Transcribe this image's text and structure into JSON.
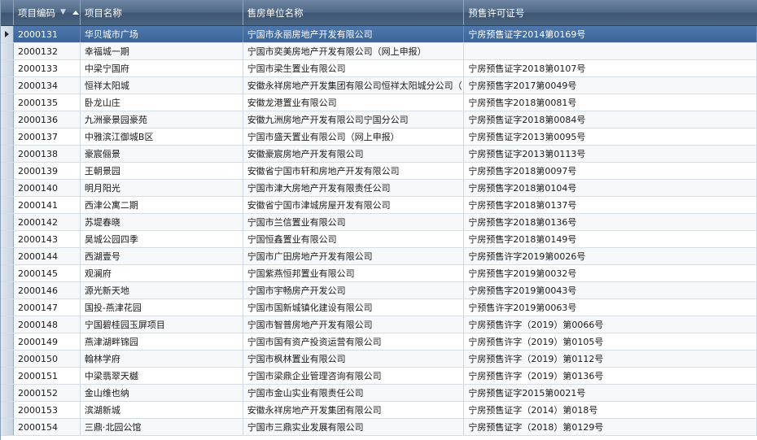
{
  "columns": {
    "code": "项目编码",
    "name": "项目名称",
    "company": "售房单位名称",
    "license": "预售许可证号"
  },
  "rows": [
    {
      "code": "2000131",
      "name": "华贝城市广场",
      "company": "宁国市永丽房地产开发有限公司",
      "license": "宁房预售证字2014第0169号"
    },
    {
      "code": "2000132",
      "name": "幸福城一期",
      "company": "宁国市奕美房地产开发有限公司（网上申报）",
      "license": ""
    },
    {
      "code": "2000133",
      "name": "中梁宁国府",
      "company": "宁国市梁生置业有限公司",
      "license": "宁房预售证字2018第0107号"
    },
    {
      "code": "2000134",
      "name": "恒祥太阳城",
      "company": "安徽永祥房地产开发集团有限公司恒祥太阳城分公司（",
      "license": "宁房预售字2017第0049号"
    },
    {
      "code": "2000135",
      "name": "卧龙山庄",
      "company": "安徽龙港置业有限公司",
      "license": "宁房预售字2018第0081号"
    },
    {
      "code": "2000136",
      "name": "九洲豪景园豪苑",
      "company": "安徽九洲房地产开发有限公司宁国分公司",
      "license": "宁房预售证字2018第0084号"
    },
    {
      "code": "2000137",
      "name": "中雅滨江御城B区",
      "company": "宁国市盛天置业有限公司（网上申报）",
      "license": "宁房预售证字2013第0095号"
    },
    {
      "code": "2000138",
      "name": "豪宸俪景",
      "company": "安徽豪宸房地产开发有限公司",
      "license": "宁房预售证字2013第0113号"
    },
    {
      "code": "2000139",
      "name": "王朝景园",
      "company": "安徽省宁国市轩和房地产开发有限公司",
      "license": "宁房预售字2018第0097号"
    },
    {
      "code": "2000140",
      "name": "明月阳光",
      "company": "宁国市津大房地产开发有限责任公司",
      "license": "宁房预售字2018第0104号"
    },
    {
      "code": "2000141",
      "name": "西津公寓二期",
      "company": "安徽省宁国市津城房屋开发有限公司",
      "license": "宁房预售字2018第0137号"
    },
    {
      "code": "2000142",
      "name": "苏堤春晓",
      "company": "宁国市兰信置业有限公司",
      "license": "宁房预售字2018第0136号"
    },
    {
      "code": "2000143",
      "name": "昊城公园四季",
      "company": "宁国恒鑫置业有限公司",
      "license": "宁房预售字2018第0149号"
    },
    {
      "code": "2000144",
      "name": "西湖壹号",
      "company": "宁国市广田房地产开发有限公司",
      "license": "宁房预售许字2019第0026号"
    },
    {
      "code": "2000145",
      "name": "观澜府",
      "company": "宁国紫燕恒邦置业有限公司",
      "license": "宁房预售字2019第0032号"
    },
    {
      "code": "2000146",
      "name": "源光新天地",
      "company": "宁国市宇畅房产开发公司",
      "license": "宁房预售字2019第0043号"
    },
    {
      "code": "2000147",
      "name": "国投-燕津花园",
      "company": "宁国市国新城镇化建设有限公司",
      "license": "宁预售许字2019第0063号"
    },
    {
      "code": "2000148",
      "name": "宁国碧桂园玉屏项目",
      "company": "宁国市智普房地产开发有限公司",
      "license": "宁房预售许字（2019）第0066号"
    },
    {
      "code": "2000149",
      "name": "燕津湖畔锦园",
      "company": "宁国市国有资产投资运营有限公司",
      "license": "宁房预售许字（2019）第0105号"
    },
    {
      "code": "2000150",
      "name": "翰林学府",
      "company": "宁国市枫林置业有限公司",
      "license": "宁房预售许字（2019）第0112号"
    },
    {
      "code": "2000151",
      "name": "中梁翡翠天樾",
      "company": "宁国市梁鼎企业管理咨询有限公司",
      "license": "宁房预售许字（2019）第0136号"
    },
    {
      "code": "2000152",
      "name": "金山维也纳",
      "company": "宁国市金山实业有限责任公司",
      "license": "宁房预售证字2015第0021号"
    },
    {
      "code": "2000153",
      "name": "滨湖新城",
      "company": "安徽永祥房地产开发集团有限公司",
      "license": "宁房预售证字（2014）第018号"
    },
    {
      "code": "2000154",
      "name": "三鼎·北园公馆",
      "company": "宁国市三鼎实业发展有限公司",
      "license": "宁房预售证字（2018）第0129号"
    }
  ],
  "selected_row": 0,
  "icons": {
    "filter": "filter-icon",
    "sort": "sort-ascending-icon",
    "row_pointer": "row-pointer-icon"
  },
  "colors": {
    "header": "#4f6885",
    "selected_row": "#3a6399"
  }
}
